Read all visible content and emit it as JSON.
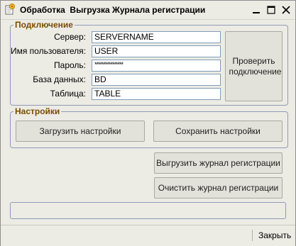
{
  "window": {
    "title": "Обработка  Выгрузка Журнала регистрации",
    "icon": "processing-form-icon",
    "controls": [
      "minimize-icon",
      "maximize-icon",
      "close-icon"
    ]
  },
  "connection": {
    "legend": "Подключение",
    "fields": [
      {
        "label": "Сервер:",
        "value": "SERVERNAME"
      },
      {
        "label": "Имя пользователя:",
        "value": "USER"
      },
      {
        "label": "Пароль:",
        "value": "****************"
      },
      {
        "label": "База данных:",
        "value": "BD"
      },
      {
        "label": "Таблица:",
        "value": "TABLE"
      }
    ],
    "check_button": "Проверить подключение"
  },
  "settings": {
    "legend": "Настройки",
    "load_button": "Загрузить настройки",
    "save_button": "Сохранить настройки"
  },
  "actions": {
    "export_button": "Выгрузить журнал регистрации",
    "clear_button": "Очистить журнал регистрации"
  },
  "footer": {
    "close_button": "Закрыть"
  }
}
